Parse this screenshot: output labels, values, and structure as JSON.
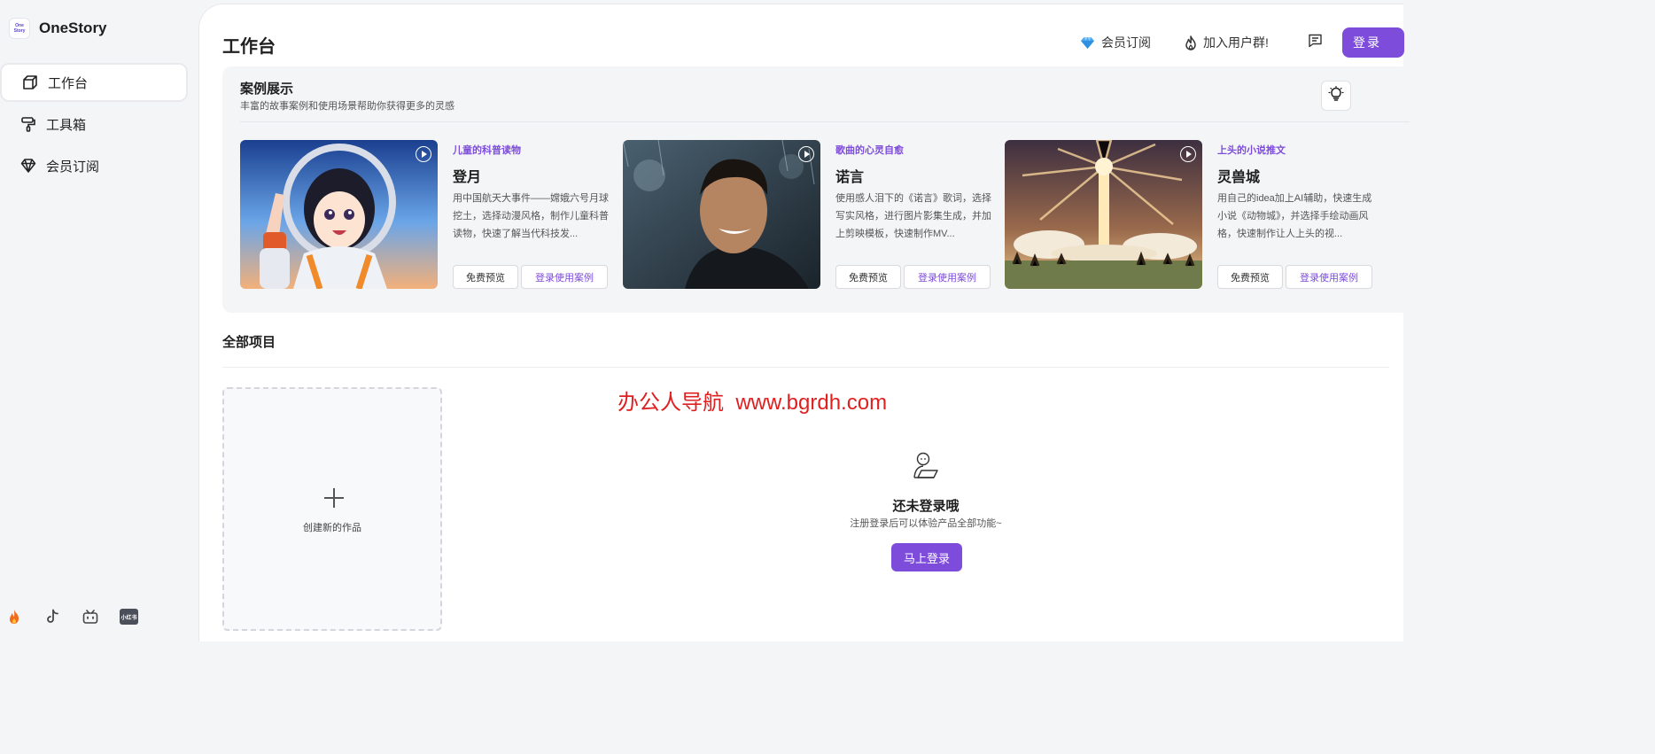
{
  "app": {
    "name": "OneStory",
    "logo_top": "One",
    "logo_bottom": "Story"
  },
  "sidebar": {
    "items": [
      {
        "label": "工作台",
        "icon": "cube-icon",
        "active": true
      },
      {
        "label": "工具箱",
        "icon": "paint-roller-icon",
        "active": false
      },
      {
        "label": "会员订阅",
        "icon": "diamond-icon",
        "active": false
      }
    ],
    "socials": [
      "fire-icon",
      "tiktok-icon",
      "bilibili-icon",
      "xiaohongshu-icon"
    ],
    "xiaohongshu_text": "小红书"
  },
  "header": {
    "title": "工作台",
    "membership_label": "会员订阅",
    "join_group_label": "加入用户群!",
    "login_label": "登录"
  },
  "showcase": {
    "title": "案例展示",
    "subtitle": "丰富的故事案例和使用场景帮助你获得更多的灵感",
    "cards": [
      {
        "tag": "儿童的科普读物",
        "title": "登月",
        "desc": "用中国航天大事件——嫦娥六号月球挖土，选择动漫风格，制作儿童科普读物，快速了解当代科技发...",
        "free_label": "免费预览",
        "case_label": "登录使用案例"
      },
      {
        "tag": "歌曲的心灵自愈",
        "title": "诺言",
        "desc": "使用感人泪下的《诺言》歌词，选择写实风格，进行图片影集生成，并加上剪映模板，快速制作MV...",
        "free_label": "免费预览",
        "case_label": "登录使用案例"
      },
      {
        "tag": "上头的小说推文",
        "title": "灵兽城",
        "desc": "用自己的idea加上AI辅助，快速生成小说《动物城》，并选择手绘动画风格，快速制作让人上头的视...",
        "free_label": "免费预览",
        "case_label": "登录使用案例"
      }
    ]
  },
  "projects": {
    "title": "全部项目",
    "new_label": "创建新的作品",
    "empty_title": "还未登录哦",
    "empty_sub": "注册登录后可以体验产品全部功能~",
    "login_now_label": "马上登录"
  },
  "watermark": "办公人导航  www.bgrdh.com",
  "colors": {
    "accent": "#7d4cdb",
    "watermark": "#e02020"
  }
}
